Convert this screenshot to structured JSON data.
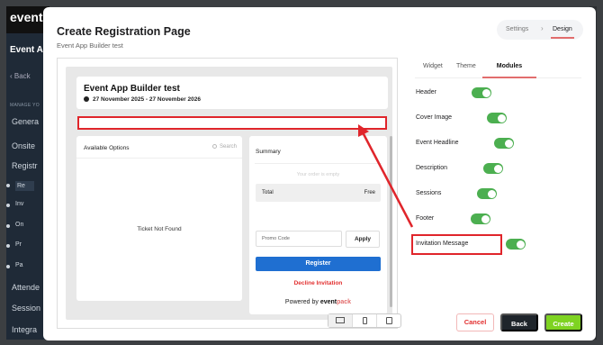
{
  "background": {
    "logo": "event",
    "event_name": "Event A",
    "back_label": "Back",
    "manage_label": "MANAGE YO",
    "nav_items": [
      {
        "label": "Genera",
        "kind": "item"
      },
      {
        "label": "Onsite",
        "kind": "item"
      },
      {
        "label": "Registr",
        "kind": "item"
      },
      {
        "label": "Re",
        "kind": "sub-active"
      },
      {
        "label": "Inv",
        "kind": "sub"
      },
      {
        "label": "On",
        "kind": "sub"
      },
      {
        "label": "Pr",
        "kind": "sub"
      },
      {
        "label": "Pa",
        "kind": "sub"
      },
      {
        "label": "Attende",
        "kind": "item"
      },
      {
        "label": "Session",
        "kind": "item"
      },
      {
        "label": "Integra",
        "kind": "item"
      }
    ]
  },
  "modal": {
    "title": "Create Registration Page",
    "subtitle": "Event App Builder test",
    "steps": {
      "settings": "Settings",
      "separator": "›",
      "design": "Design",
      "active": "Design"
    }
  },
  "preview": {
    "event_title": "Event App Builder test",
    "dates": "27 November 2025 - 27 November 2026",
    "available_options_title": "Available Options",
    "search_placeholder": "Search",
    "empty_tickets": "Ticket Not Found",
    "summary_title": "Summary",
    "empty_order": "Your order is empty",
    "total_label": "Total",
    "total_value": "Free",
    "promo_placeholder": "Promo Code",
    "apply_label": "Apply",
    "register_label": "Register",
    "decline_label": "Decline Invitation",
    "powered_by": "Powered by",
    "brand_main": "event",
    "brand_accent": "pack",
    "device_modes": [
      "desktop-icon",
      "mobile-icon",
      "tablet-icon"
    ],
    "selected_device": "desktop"
  },
  "tabs": {
    "items": [
      "Widget",
      "Theme",
      "Modules"
    ],
    "active": "Modules"
  },
  "modules": [
    {
      "label": "Header",
      "enabled": true
    },
    {
      "label": "Cover Image",
      "enabled": true
    },
    {
      "label": "Event Headline",
      "enabled": true
    },
    {
      "label": "Description",
      "enabled": true
    },
    {
      "label": "Sessions",
      "enabled": true
    },
    {
      "label": "Footer",
      "enabled": true
    },
    {
      "label": "Invitation Message",
      "enabled": true,
      "highlighted": true
    }
  ],
  "buttons": {
    "cancel": "Cancel",
    "back": "Back",
    "create": "Create"
  },
  "colors": {
    "accent": "#e26d6d",
    "toggle_on": "#4caf50",
    "register": "#1f6fd1",
    "create": "#7ed321",
    "annotation": "#e0252b"
  }
}
